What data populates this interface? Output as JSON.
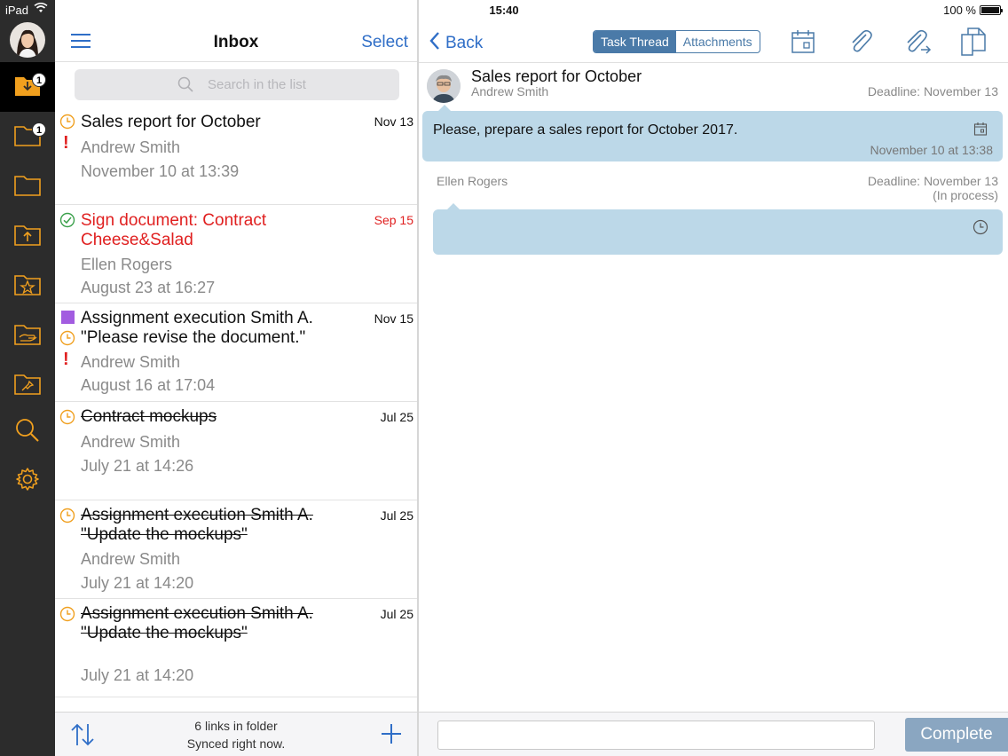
{
  "status_bar": {
    "device": "iPad",
    "time": "15:40",
    "battery": "100 %",
    "battery_level": 1.0
  },
  "sidebar": {
    "badges": {
      "inbox": "1",
      "outbox": "1"
    }
  },
  "list": {
    "title": "Inbox",
    "select_label": "Select",
    "search_placeholder": "Search in the list",
    "items": [
      {
        "subject": "Sales report for October",
        "from": "Andrew Smith",
        "when": "November 10 at 13:39",
        "date": "Nov 13"
      },
      {
        "subject": "Sign document: Contract Cheese&Salad",
        "from": "Ellen Rogers",
        "when": "August 23 at 16:27",
        "date": "Sep 15"
      },
      {
        "subject": "Assignment execution Smith A. \"Please revise the document.\"",
        "from": "Andrew Smith",
        "when": "August 16 at 17:04",
        "date": "Nov 15"
      },
      {
        "subject": "Contract mockups",
        "from": "Andrew Smith",
        "when": "July 21 at 14:26",
        "date": "Jul 25"
      },
      {
        "subject": "Assignment execution Smith A. \"Update the mockups\"",
        "from": "Andrew Smith",
        "when": "July 21 at 14:20",
        "date": "Jul 25"
      },
      {
        "subject": "Assignment execution Smith A. \"Update the mockups\"",
        "from": "",
        "when": "July 21 at 14:20",
        "date": "Jul 25"
      }
    ],
    "footer_line1": "6 links in folder",
    "footer_line2": "Synced right now."
  },
  "detail": {
    "back_label": "Back",
    "tabs": [
      "Task Thread",
      "Attachments"
    ],
    "task_title": "Sales report for October",
    "task_author": "Andrew Smith",
    "task_deadline": "Deadline: November 13",
    "message_text": "Please, prepare a sales report for October 2017.",
    "message_time": "November 10 at 13:38",
    "reply_name": "Ellen Rogers",
    "reply_deadline": "Deadline: November 13",
    "reply_status": "(In process)",
    "complete_label": "Complete"
  },
  "colors": {
    "accent": "#2f6ec7",
    "sidebar": "#2c2c2c",
    "bubble": "#bcd8e8",
    "alert": "#e02020",
    "clock": "#f0a020",
    "done": "#3aa04a"
  }
}
